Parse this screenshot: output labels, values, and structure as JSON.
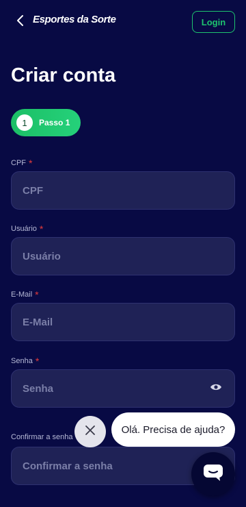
{
  "header": {
    "logo_text": "Esportes da Sorte",
    "login_label": "Login"
  },
  "page": {
    "title": "Criar conta"
  },
  "step": {
    "number": "1",
    "label": "Passo 1"
  },
  "form": {
    "cpf": {
      "label": "CPF",
      "placeholder": "CPF",
      "value": ""
    },
    "username": {
      "label": "Usuário",
      "placeholder": "Usuário",
      "value": ""
    },
    "email": {
      "label": "E-Mail",
      "placeholder": "E-Mail",
      "value": ""
    },
    "password": {
      "label": "Senha",
      "placeholder": "Senha",
      "value": ""
    },
    "confirm_password": {
      "label": "Confirmar a senha",
      "placeholder": "Confirmar a senha",
      "value": ""
    },
    "required_mark": "*"
  },
  "chat": {
    "greeting": "Olá. Precisa de ajuda?"
  },
  "icons": [
    "chevron-left-icon",
    "eye-icon",
    "close-icon",
    "chat-icon"
  ],
  "colors": {
    "background": "#080a44",
    "accent": "#1ec46f",
    "input_bg": "#1f2256",
    "required": "#e53b3b"
  }
}
